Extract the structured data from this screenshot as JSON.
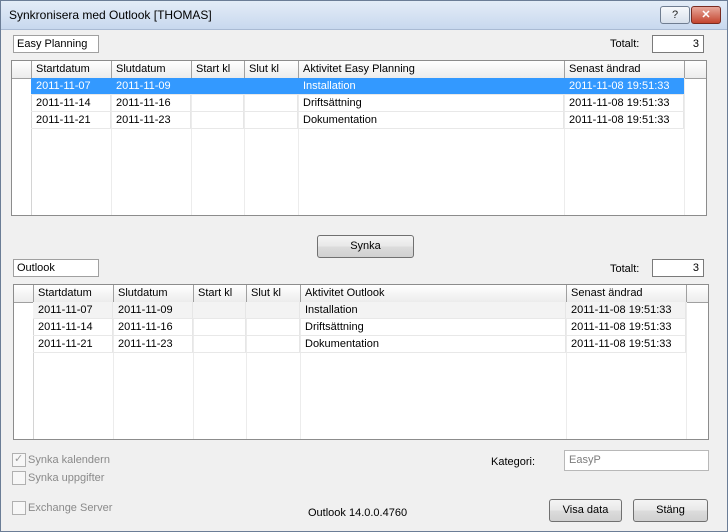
{
  "window": {
    "title": "Synkronisera med Outlook [THOMAS]",
    "help_glyph": "?",
    "close_glyph": "✕"
  },
  "top": {
    "source_label": "Easy Planning",
    "total_label": "Totalt:",
    "total_value": "3",
    "columns": [
      "Startdatum",
      "Slutdatum",
      "Start kl",
      "Slut kl",
      "Aktivitet Easy Planning",
      "Senast ändrad"
    ],
    "rows": [
      [
        "2011-11-07",
        "2011-11-09",
        "",
        "",
        "Installation",
        "2011-11-08 19:51:33"
      ],
      [
        "2011-11-14",
        "2011-11-16",
        "",
        "",
        "Driftsättning",
        "2011-11-08 19:51:33"
      ],
      [
        "2011-11-21",
        "2011-11-23",
        "",
        "",
        "Dokumentation",
        "2011-11-08 19:51:33"
      ]
    ]
  },
  "sync_button": "Synka",
  "bottom": {
    "source_label": "Outlook",
    "total_label": "Totalt:",
    "total_value": "3",
    "columns": [
      "Startdatum",
      "Slutdatum",
      "Start kl",
      "Slut kl",
      "Aktivitet Outlook",
      "Senast ändrad"
    ],
    "rows": [
      [
        "2011-11-07",
        "2011-11-09",
        "",
        "",
        "Installation",
        "2011-11-08 19:51:33"
      ],
      [
        "2011-11-14",
        "2011-11-16",
        "",
        "",
        "Driftsättning",
        "2011-11-08 19:51:33"
      ],
      [
        "2011-11-21",
        "2011-11-23",
        "",
        "",
        "Dokumentation",
        "2011-11-08 19:51:33"
      ]
    ]
  },
  "options": {
    "sync_calendar": "Synka kalendern",
    "sync_tasks": "Synka uppgifter",
    "exchange_server": "Exchange Server"
  },
  "category": {
    "label": "Kategori:",
    "value": "EasyP"
  },
  "version": "Outlook 14.0.0.4760",
  "buttons": {
    "show_data": "Visa data",
    "close": "Stäng"
  },
  "colors": {
    "selection": "#3399ff",
    "title_bar": "#c8d8ee"
  }
}
